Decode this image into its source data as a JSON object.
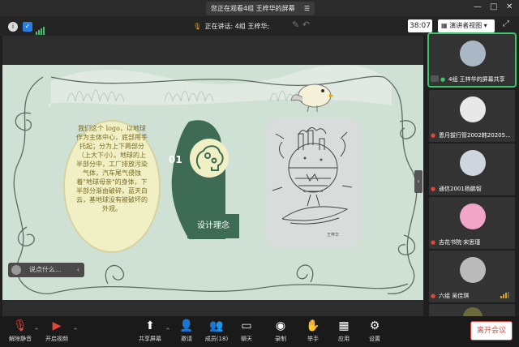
{
  "titlebar": {
    "title": "您正在观看4组 王梓华的屏幕",
    "chevron": "☰",
    "minimize": "—",
    "maximize": "□",
    "close": "✕"
  },
  "infobar": {
    "speaker_prefix": "正在讲话:",
    "speaker_name": "4组 王梓华;",
    "timer": "38:07",
    "view_button": "演讲者视图",
    "view_caret": "▾"
  },
  "slide": {
    "oval_text": "我们这个 logo，以地球作为主体中心，底部用手托起；分为上下两部分（上大下小）。地球的上半部分中，工厂排放污染气体，汽车尾气侵蚀着\"地球母亲\"的身体，下半部分渐由破碎，蓝天白云，基地球没有被破坏的外观。",
    "number": "01",
    "design_label": "设计理念",
    "sketch_signature": "王梓华",
    "chat_placeholder": "说点什么...",
    "chat_arrow": "‹",
    "collapse_arrow": "›"
  },
  "participants": [
    {
      "name": "4组 王梓华的屏幕共享",
      "mic": "on",
      "active": true
    },
    {
      "name": "恩月拔行管2002韩20205...",
      "mic": "off",
      "active": false
    },
    {
      "name": "通信2001杨鹏智",
      "mic": "off",
      "active": false
    },
    {
      "name": "吉花书院·宋思瑾",
      "mic": "off",
      "active": false
    },
    {
      "name": "六组 吴佳琪",
      "mic": "off",
      "active": false
    }
  ],
  "toolbar": {
    "items": [
      {
        "id": "unmute",
        "label": "解除静音",
        "icon": "mic-off-icon"
      },
      {
        "id": "video",
        "label": "开启视频",
        "icon": "video-off-icon"
      },
      {
        "id": "share",
        "label": "共享屏幕",
        "icon": "share-screen-icon"
      },
      {
        "id": "invite",
        "label": "邀请",
        "icon": "invite-icon"
      },
      {
        "id": "members",
        "label": "成员(18)",
        "icon": "members-icon"
      },
      {
        "id": "chat",
        "label": "聊天",
        "icon": "chat-icon"
      },
      {
        "id": "record",
        "label": "录制",
        "icon": "record-icon"
      },
      {
        "id": "hand",
        "label": "举手",
        "icon": "raise-hand-icon"
      },
      {
        "id": "apps",
        "label": "应用",
        "icon": "apps-icon"
      },
      {
        "id": "settings",
        "label": "设置",
        "icon": "gear-icon"
      }
    ],
    "leave_label": "离开会议"
  },
  "colors": {
    "accent_green": "#3d6b53",
    "leave_red": "#e0473a",
    "active_green": "#3cc46b"
  }
}
